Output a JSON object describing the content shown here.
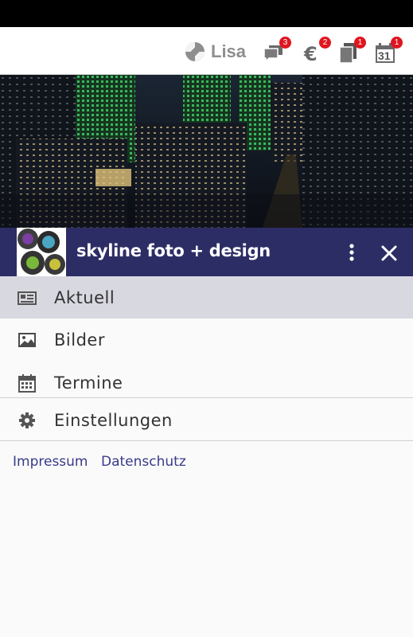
{
  "header": {
    "user_name": "Lisa",
    "icons": [
      {
        "name": "chat-icon",
        "badge": "3"
      },
      {
        "name": "euro-icon",
        "badge": "2"
      },
      {
        "name": "documents-icon",
        "badge": "1"
      },
      {
        "name": "calendar-icon",
        "badge": "1",
        "day": "31"
      }
    ]
  },
  "org": {
    "title": "skyline foto + design"
  },
  "menu": {
    "items": [
      {
        "label": "Aktuell",
        "icon": "newspaper-icon",
        "active": true
      },
      {
        "label": "Bilder",
        "icon": "image-icon",
        "active": false
      },
      {
        "label": "Termine",
        "icon": "calendar-icon",
        "active": false
      },
      {
        "label": "Einstellungen",
        "icon": "gear-icon",
        "active": false
      }
    ]
  },
  "footer": {
    "impressum": "Impressum",
    "datenschutz": "Datenschutz"
  },
  "colors": {
    "org_bar": "#2d2d66",
    "active_item": "#d8d8e0",
    "badge": "#e0151f",
    "link": "#3a3a8a"
  }
}
